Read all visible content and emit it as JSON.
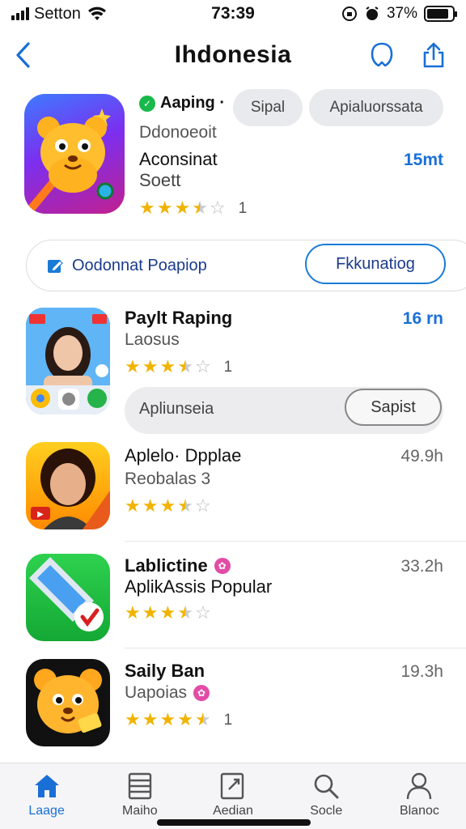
{
  "status_bar": {
    "carrier": "Setton",
    "time": "73:39",
    "battery": "37%",
    "battery_level": 0.86
  },
  "nav": {
    "title": "Ihdonesia"
  },
  "featured": {
    "name": "Aaping ·",
    "chip_left": "Sipal",
    "chip_right": "Apialuorssata",
    "developer": "Ddonoeoit",
    "subtitle_line1": "Aconsinat",
    "subtitle_line2": "Soett",
    "size": "15mt",
    "rating": 3.5,
    "rating_count": "1",
    "icon": "cartoon-bear-icon"
  },
  "promo": {
    "text": "Oodonnat Poapiop",
    "button_label": "Fkkunatiog",
    "icon": "edit-icon"
  },
  "list": [
    {
      "title": "Paylt Raping",
      "subtitle": "Laosus",
      "right": "16 rn",
      "right_accent": true,
      "rating": 3.5,
      "rating_count": "1",
      "icon": "portrait-collage-icon",
      "inner_text": "Apliunseia",
      "inner_button": "Sapist"
    },
    {
      "title": "Aplelo· Dpplae",
      "subtitle": "Reobalas 3",
      "right": "49.9h",
      "right_accent": false,
      "rating": 3.5,
      "rating_count": "",
      "icon": "portrait-icon"
    },
    {
      "title": "Lablictine",
      "subtitle": "AplikAssis Popular",
      "right": "33.2h",
      "right_accent": false,
      "rating": 3.5,
      "rating_count": "",
      "icon": "cleaner-icon"
    },
    {
      "title": "Saily Ban",
      "subtitle": "Uapoias",
      "right": "19.3h",
      "right_accent": false,
      "rating": 4.5,
      "rating_count": "1",
      "icon": "bear-face-icon"
    }
  ],
  "tabs": [
    {
      "label": "Laage",
      "icon": "home-icon",
      "active": true
    },
    {
      "label": "Maiho",
      "icon": "list-icon",
      "active": false
    },
    {
      "label": "Aedian",
      "icon": "document-icon",
      "active": false
    },
    {
      "label": "Socle",
      "icon": "search-icon",
      "active": false
    },
    {
      "label": "Blanoc",
      "icon": "person-icon",
      "active": false
    }
  ],
  "colors": {
    "accent": "#1a6fd6",
    "star": "#f0b400",
    "pink_badge": "#e24ca6",
    "green_badge": "#18b84a"
  }
}
